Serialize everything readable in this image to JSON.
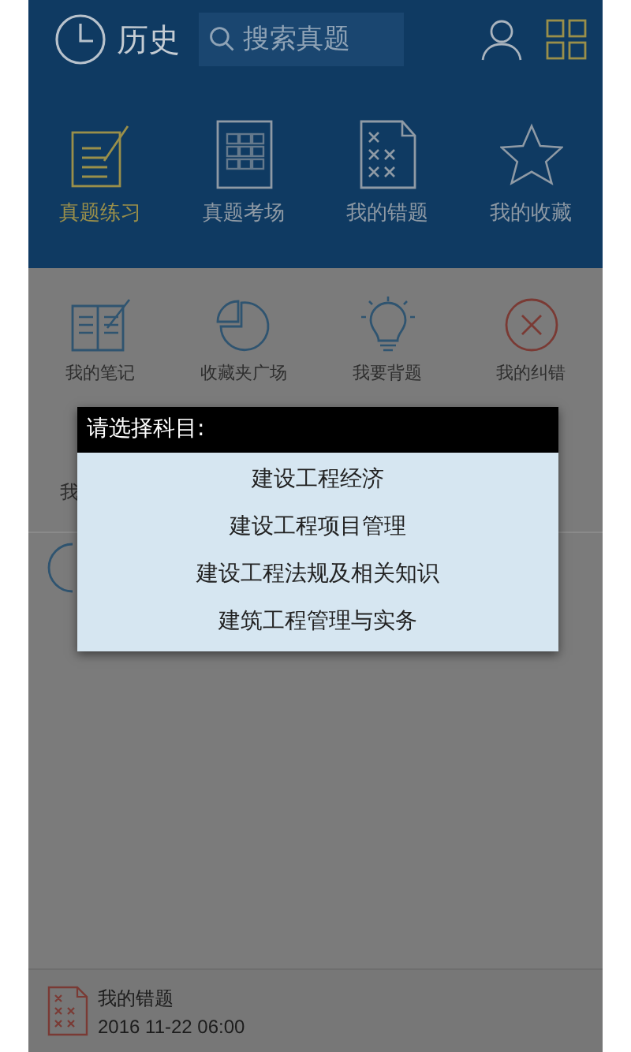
{
  "header": {
    "history_label": "历史",
    "search": {
      "placeholder": "搜索真题"
    }
  },
  "main_nav": [
    {
      "label": "真题练习",
      "kind": "practice",
      "selected": true
    },
    {
      "label": "真题考场",
      "kind": "exam",
      "selected": false
    },
    {
      "label": "我的错题",
      "kind": "mistakes",
      "selected": false
    },
    {
      "label": "我的收藏",
      "kind": "favorites",
      "selected": false
    }
  ],
  "tools": [
    {
      "label": "我的笔记",
      "kind": "notes"
    },
    {
      "label": "收藏夹广场",
      "kind": "pie"
    },
    {
      "label": "我要背题",
      "kind": "bulb"
    },
    {
      "label": "我的纠错",
      "kind": "error"
    }
  ],
  "hidden_row_fragment": "我",
  "dialog": {
    "title": "请选择科目:",
    "options": [
      "建设工程经济",
      "建设工程项目管理",
      "建设工程法规及相关知识",
      "建筑工程管理与实务"
    ]
  },
  "recent": {
    "title": "我的错题",
    "time": "2016 11-22 06:00"
  }
}
